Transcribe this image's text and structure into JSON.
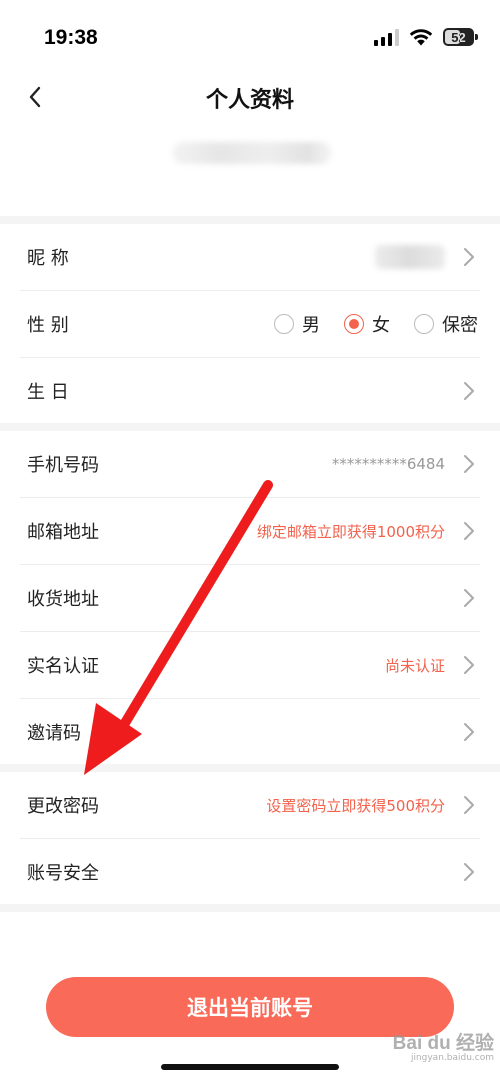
{
  "status_bar": {
    "time": "19:38",
    "battery": "52"
  },
  "header": {
    "title": "个人资料"
  },
  "rows": {
    "nickname": {
      "label": "昵 称"
    },
    "gender": {
      "label": "性 别",
      "options": [
        {
          "label": "男",
          "checked": false
        },
        {
          "label": "女",
          "checked": true
        },
        {
          "label": "保密",
          "checked": false
        }
      ]
    },
    "birthday": {
      "label": "生 日"
    },
    "phone": {
      "label": "手机号码",
      "value": "**********6484"
    },
    "email": {
      "label": "邮箱地址",
      "value": "绑定邮箱立即获得1000积分"
    },
    "address": {
      "label": "收货地址"
    },
    "verification": {
      "label": "实名认证",
      "value": "尚未认证"
    },
    "invite": {
      "label": "邀请码"
    },
    "password": {
      "label": "更改密码",
      "value": "设置密码立即获得500积分"
    },
    "security": {
      "label": "账号安全"
    }
  },
  "logout_label": "退出当前账号",
  "colors": {
    "accent": "#f2624c",
    "button": "#f96a58",
    "arrow": "#ee1c1c"
  },
  "watermark": {
    "logo": "Bai du 经验",
    "sub": "jingyan.baidu.com"
  }
}
